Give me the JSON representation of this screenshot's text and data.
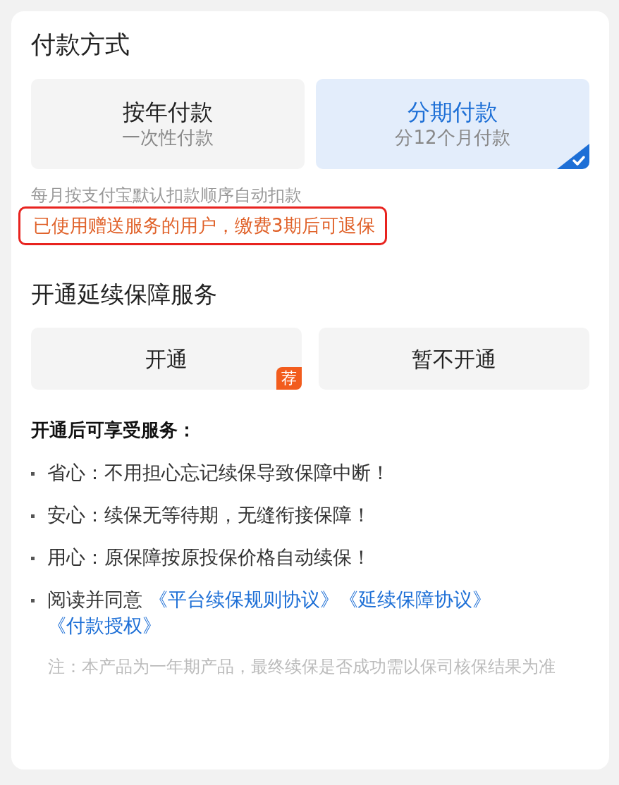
{
  "payment": {
    "title": "付款方式",
    "options": [
      {
        "label": "按年付款",
        "sub": "一次性付款",
        "selected": false
      },
      {
        "label": "分期付款",
        "sub": "分12个月付款",
        "selected": true
      }
    ],
    "note": "每月按支付宝默认扣款顺序自动扣款",
    "notice": {
      "text": "已使用赠送服务的用户，缴费3期后可退保",
      "highlighted": true
    }
  },
  "renewal": {
    "title": "开通延续保障服务",
    "buttons": [
      {
        "label": "开通",
        "badge": "荐"
      },
      {
        "label": "暂不开通"
      }
    ],
    "benefits_title": "开通后可享受服务：",
    "benefits": [
      {
        "kind": "text",
        "text": "省心：不用担心忘记续保导致保障中断！"
      },
      {
        "kind": "text",
        "text": "安心：续保无等待期，无缝衔接保障！"
      },
      {
        "kind": "text",
        "text": "用心：原保障按原投保价格自动续保！"
      },
      {
        "kind": "agreement",
        "text": "阅读并同意",
        "links": [
          "《平台续保规则协议》",
          "《延续保障协议》",
          "《付款授权》"
        ]
      }
    ],
    "footnote": "注：本产品为一年期产品，最终续保是否成功需以保司核保结果为准"
  }
}
